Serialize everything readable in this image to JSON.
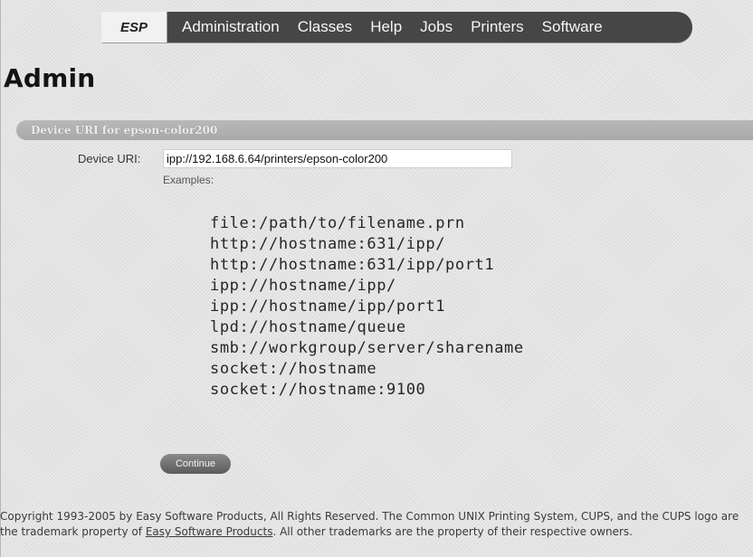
{
  "nav": {
    "logo": "ESP",
    "items": [
      {
        "label": "Administration"
      },
      {
        "label": "Classes"
      },
      {
        "label": "Help"
      },
      {
        "label": "Jobs"
      },
      {
        "label": "Printers"
      },
      {
        "label": "Software"
      }
    ]
  },
  "page": {
    "title": "Admin"
  },
  "section": {
    "header": "Device URI for epson-color200"
  },
  "form": {
    "uri_label": "Device URI:",
    "uri_value": "ipp://192.168.6.64/printers/epson-color200",
    "examples_label": "Examples:",
    "examples": [
      "file:/path/to/filename.prn",
      "http://hostname:631/ipp/",
      "http://hostname:631/ipp/port1",
      "ipp://hostname/ipp/",
      "ipp://hostname/ipp/port1",
      "lpd://hostname/queue",
      "smb://workgroup/server/sharename",
      "socket://hostname",
      "socket://hostname:9100"
    ],
    "continue_label": "Continue"
  },
  "footer": {
    "text_before": "Copyright 1993-2005 by Easy Software Products, All Rights Reserved. The Common UNIX Printing System, CUPS, and the CUPS logo are the trademark property of ",
    "link_text": "Easy Software Products",
    "text_after": ". All other trademarks are the property of their respective owners."
  }
}
